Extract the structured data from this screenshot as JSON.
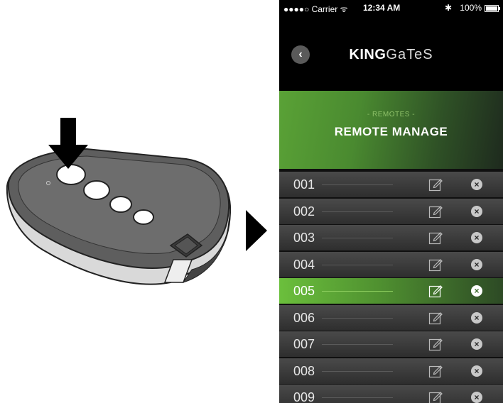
{
  "status_bar": {
    "carrier": "●●●●○ Carrier ᯤ",
    "time": "12:34 AM",
    "bluetooth": "✱",
    "battery": "100%"
  },
  "header": {
    "back_glyph": "‹",
    "logo_bold": "KING",
    "logo_light": "GaTeS"
  },
  "banner": {
    "subtitle": "- REMOTES -",
    "title": "REMOTE MANAGE"
  },
  "remotes": [
    {
      "number": "001",
      "selected": false
    },
    {
      "number": "002",
      "selected": false
    },
    {
      "number": "003",
      "selected": false
    },
    {
      "number": "004",
      "selected": false
    },
    {
      "number": "005",
      "selected": true
    },
    {
      "number": "006",
      "selected": false
    },
    {
      "number": "007",
      "selected": false
    },
    {
      "number": "008",
      "selected": false
    },
    {
      "number": "009",
      "selected": false
    }
  ],
  "icons": {
    "edit": "edit-icon",
    "delete": "delete-icon",
    "arrow": "play-arrow-icon",
    "press": "down-arrow-icon"
  },
  "colors": {
    "accent_green": "#5aa236",
    "row_dark": "#2e2e2e"
  }
}
